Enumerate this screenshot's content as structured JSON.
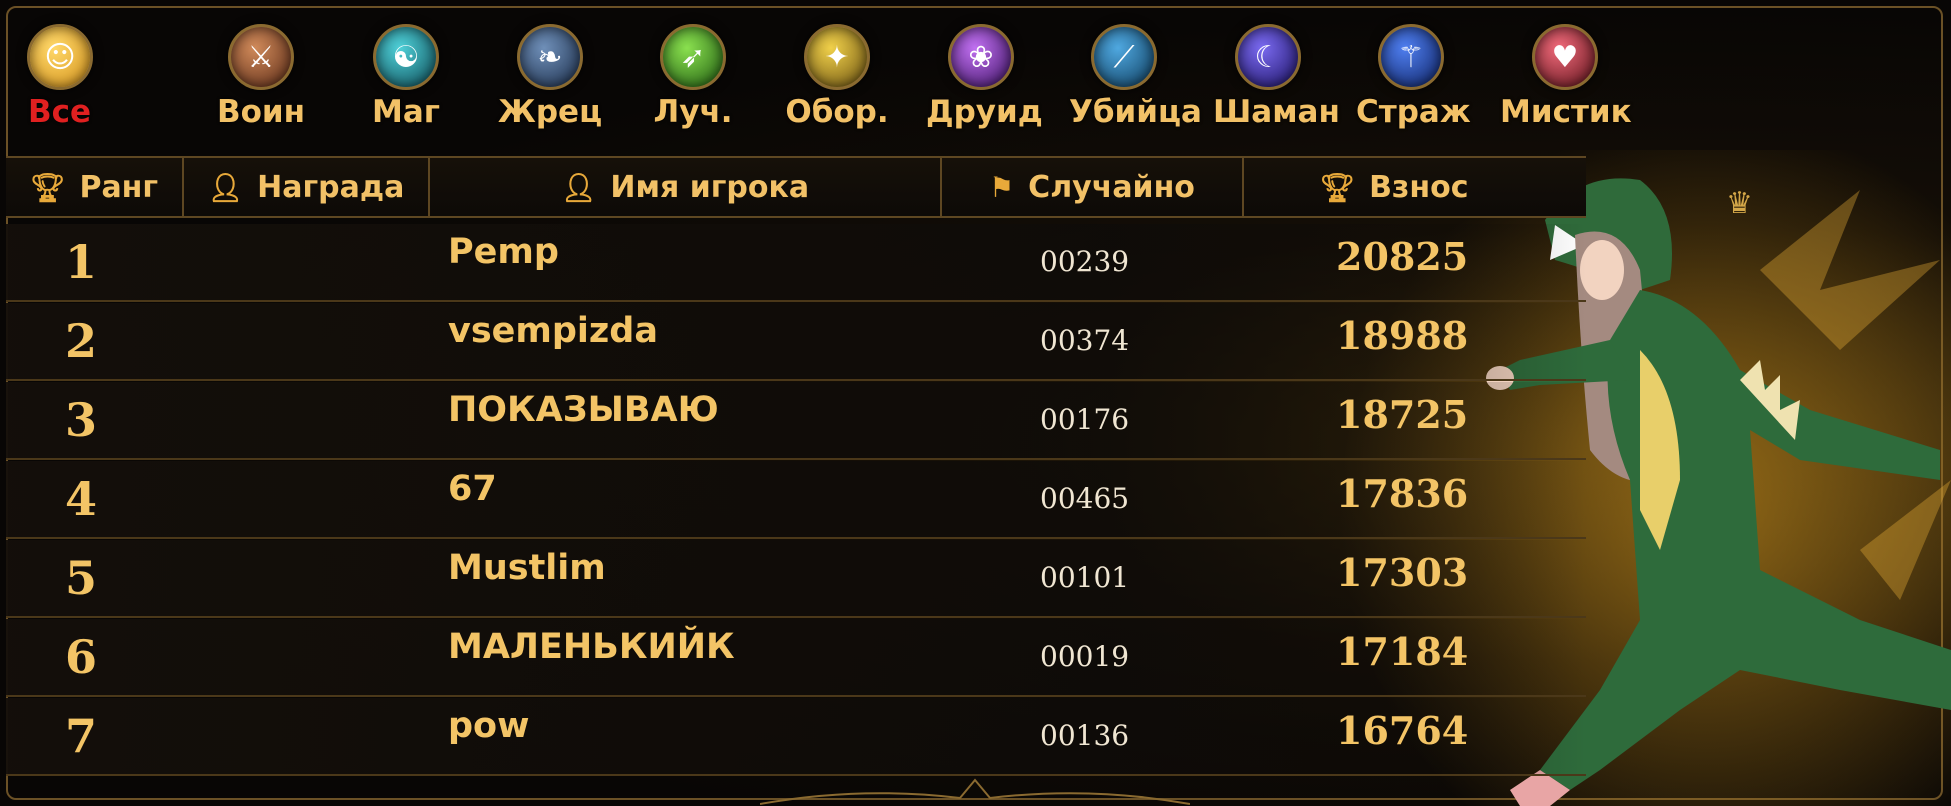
{
  "classes": [
    {
      "label": "Все",
      "icon": "smiley-icon",
      "color": "#f0b53a",
      "active": true
    },
    {
      "label": "Воин",
      "icon": "warrior-icon",
      "color": "#8a4a2a"
    },
    {
      "label": "Маг",
      "icon": "yin-yang-icon",
      "color": "#1d7f8f"
    },
    {
      "label": "Жрец",
      "icon": "wing-icon",
      "color": "#2a4f7a"
    },
    {
      "label": "Луч.",
      "icon": "archer-icon",
      "color": "#3f9a2a"
    },
    {
      "label": "Обор.",
      "icon": "shapeshifter-icon",
      "color": "#b89420"
    },
    {
      "label": "Друид",
      "icon": "druid-icon",
      "color": "#7a2aa0"
    },
    {
      "label": "Убийца",
      "icon": "assassin-icon",
      "color": "#1d6a9a"
    },
    {
      "label": "Шаман",
      "icon": "moon-icon",
      "color": "#3a2aa0"
    },
    {
      "label": "Страж",
      "icon": "guardian-icon",
      "color": "#1f4fb0"
    },
    {
      "label": "Мистик",
      "icon": "mystic-icon",
      "color": "#b02a3a"
    }
  ],
  "headers": {
    "rank": "Ранг",
    "reward": "Награда",
    "player": "Имя игрока",
    "random": "Случайно",
    "contribution": "Взнос"
  },
  "rows": [
    {
      "rank": "1",
      "name": "Pemp",
      "random": "00239",
      "contribution": "20825"
    },
    {
      "rank": "2",
      "name": "vsempizda",
      "random": "00374",
      "contribution": "18988"
    },
    {
      "rank": "3",
      "name": "ПОКАЗЫВАЮ",
      "random": "00176",
      "contribution": "18725"
    },
    {
      "rank": "4",
      "name": "67",
      "random": "00465",
      "contribution": "17836"
    },
    {
      "rank": "5",
      "name": "Mustlim",
      "random": "00101",
      "contribution": "17303"
    },
    {
      "rank": "6",
      "name": "МАЛЕНЬКИЙК",
      "random": "00019",
      "contribution": "17184"
    },
    {
      "rank": "7",
      "name": "pow",
      "random": "00136",
      "contribution": "16764"
    }
  ],
  "colors": {
    "gold": "#f3c466",
    "active": "#e02020",
    "border": "#6b5126"
  }
}
